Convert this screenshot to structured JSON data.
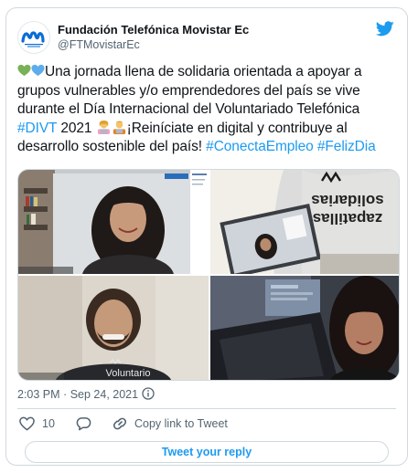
{
  "account": {
    "display_name": "Fundación Telefónica Movistar Ec",
    "handle": "@FTMovistarEc"
  },
  "tweet": {
    "text_part1": "Una jornada llena de solidaria orientada a apoyar a grupos vulnerables y/o emprendedores del país se vive durante el Día Internacional del Voluntariado Telefónica ",
    "hashtag1": "#DIVT",
    "text_part2": " 2021 ",
    "text_part3": "¡Reiníciate en digital y contribuye al desarrollo sostenible del país! ",
    "hashtag2": "#ConectaEmpleo",
    "hashtag3": "#FelizDia"
  },
  "media": {
    "shirt_text_1": "zapatillas",
    "shirt_text_2": "solidarias",
    "shirt_text_3": "Voluntario"
  },
  "meta": {
    "time": "2:03 PM",
    "separator": "·",
    "date": "Sep 24, 2021"
  },
  "actions": {
    "like_count": "10",
    "copy_link_label": "Copy link to Tweet"
  },
  "reply_button_label": "Tweet your reply",
  "colors": {
    "link": "#1d9bf0",
    "heart_green": "#78b159",
    "heart_blue": "#5dadec",
    "brand_blue": "#0b6cd6"
  }
}
